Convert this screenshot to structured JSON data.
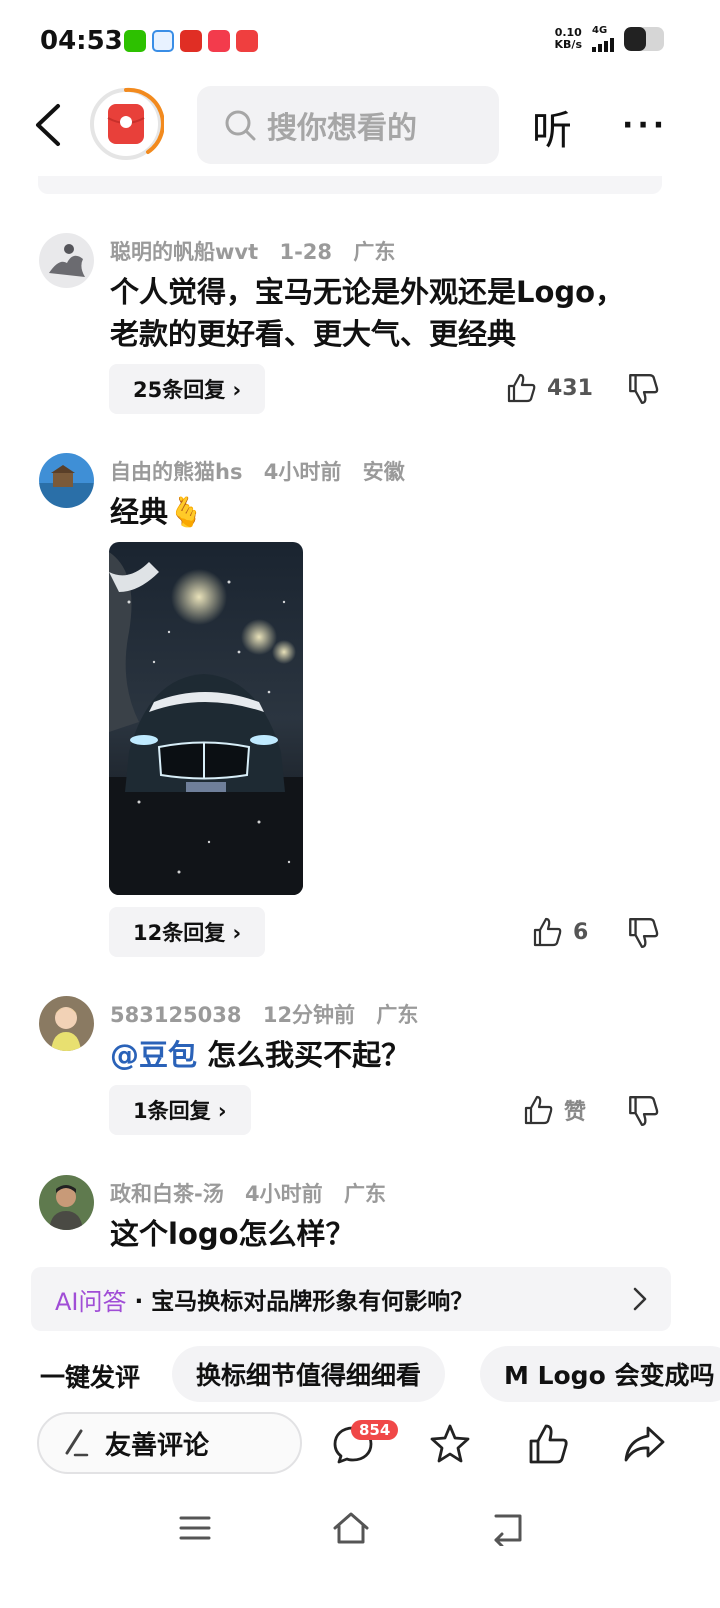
{
  "status_bar": {
    "time": "04:53",
    "net_speed_value": "0.10",
    "net_speed_unit": "KB/s",
    "network": "4G",
    "battery_level": 0.55
  },
  "top_bar": {
    "search_placeholder": "搜你想看的",
    "listen_label": "听",
    "more_label": "···"
  },
  "comments": [
    {
      "user": "聪明的帆船wvt",
      "time": "1-28",
      "location": "广东",
      "text_lines": [
        "个人觉得，宝马无论是外观还是Logo，",
        "老款的更好看、更大气、更经典"
      ],
      "reply_label": "25条回复 ›",
      "likes": "431"
    },
    {
      "user": "自由的熊猫hs",
      "time": "4小时前",
      "location": "安徽",
      "text": "经典",
      "emoji": "🫰",
      "reply_label": "12条回复 ›",
      "likes": "6"
    },
    {
      "user": "583125038",
      "time": "12分钟前",
      "location": "广东",
      "mention": "@豆包",
      "text": "怎么我买不起？",
      "reply_label": "1条回复 ›",
      "likes": "赞"
    },
    {
      "user": "政和白茶-汤",
      "time": "4小时前",
      "location": "广东",
      "text": "这个logo怎么样？"
    }
  ],
  "ai_bar": {
    "label": "AI问答",
    "question": "· 宝马换标对品牌形象有何影响？"
  },
  "quick_comments": {
    "title": "一键发评",
    "chips": [
      "换标细节值得细细看",
      "M Logo 会变成吗"
    ]
  },
  "bottom_bar": {
    "input_label": "友善评论",
    "comment_count": "854"
  },
  "colors": {
    "accent_orange": "#f28a1e",
    "channel_red": "#e8403a",
    "mention_blue": "#2a62b8",
    "ai_purple": "#a04dd6",
    "badge_red": "#f04848"
  }
}
